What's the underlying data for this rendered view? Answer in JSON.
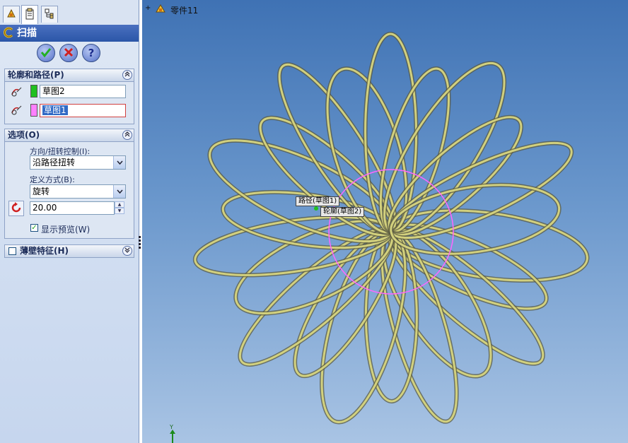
{
  "tabs": [
    {
      "icon": "feature-tree-icon"
    },
    {
      "icon": "property-manager-icon"
    },
    {
      "icon": "configuration-manager-icon"
    }
  ],
  "feature": {
    "title": "扫描",
    "icon": "sweep-icon"
  },
  "actions": [
    {
      "icon": "ok-check-icon",
      "color": "#2a9a2a"
    },
    {
      "icon": "cancel-x-icon",
      "color": "#c02020"
    },
    {
      "icon": "help-question-icon",
      "color": "#1b2b8c"
    }
  ],
  "profile_path": {
    "header": "轮廓和路径(P)",
    "profile": {
      "value": "草图2",
      "color": "#20c020"
    },
    "path": {
      "value": "草图1",
      "color": "#ff80ff"
    }
  },
  "options": {
    "header": "选项(O)",
    "orientation_label": "方向/扭转控制(I):",
    "orientation_value": "沿路径扭转",
    "define_label": "定义方式(B):",
    "define_value": "旋转",
    "twist_value": "20.00",
    "show_preview_label": "显示预览(W)",
    "show_preview_checked": true
  },
  "thin_feature": {
    "header": "薄壁特征(H)",
    "checked": false
  },
  "viewport": {
    "part_name": "零件11",
    "callout_path": "路径(草图1)",
    "callout_profile": "轮廓(草图2)",
    "triad_y": "Y",
    "colors": {
      "tube": "#d8d680",
      "path_circle": "#ff66ff",
      "bg_top": "#3f72b4",
      "bg_bottom": "#a9c4e4"
    }
  }
}
